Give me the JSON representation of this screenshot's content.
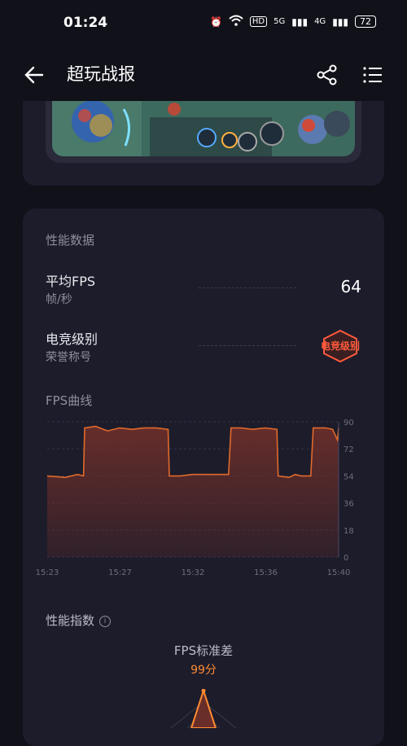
{
  "status_bar": {
    "time": "01:24",
    "signal1_label": "5G",
    "signal2_label": "4G",
    "hd_label": "HD",
    "battery": "72"
  },
  "app_bar": {
    "title": "超玩战报",
    "back_icon": "arrow-left-icon",
    "share_icon": "share-icon",
    "menu_icon": "list-menu-icon"
  },
  "performance": {
    "section_title": "性能数据",
    "avg_fps_label": "平均FPS",
    "avg_fps_unit": "帧/秒",
    "avg_fps_value": "64",
    "esports_label": "电竞级别",
    "esports_sub": "荣誉称号",
    "esports_badge": "电竞级别",
    "chart_title": "FPS曲线"
  },
  "chart_data": {
    "type": "area",
    "x_ticks": [
      "15:23",
      "15:27",
      "15:32",
      "15:36",
      "15:40"
    ],
    "y_ticks": [
      0,
      18,
      36,
      54,
      72,
      90
    ],
    "ylim": [
      0,
      90
    ],
    "x": [
      0,
      1.5,
      2.5,
      3,
      3.1,
      4,
      5,
      6,
      7,
      8,
      9,
      10,
      10.1,
      11,
      12,
      15,
      15.2,
      16,
      17,
      18,
      19,
      19.1,
      20,
      20.5,
      21,
      21.8,
      22,
      23,
      23.6,
      24,
      24.1
    ],
    "values": [
      54,
      53,
      55,
      54,
      86,
      87,
      84,
      86,
      85,
      86,
      86,
      85,
      54,
      54,
      55,
      55,
      86,
      86,
      85,
      86,
      85,
      54,
      53,
      55,
      54,
      54,
      86,
      86,
      85,
      78,
      86
    ],
    "xlim": [
      0,
      24.1
    ],
    "grid": true,
    "line_color": "#e06a2a",
    "fill_color": "#6a2e2a"
  },
  "performance_index": {
    "title": "性能指数",
    "info_icon": "info-icon",
    "metric_title": "FPS标准差",
    "metric_score": "99分"
  }
}
